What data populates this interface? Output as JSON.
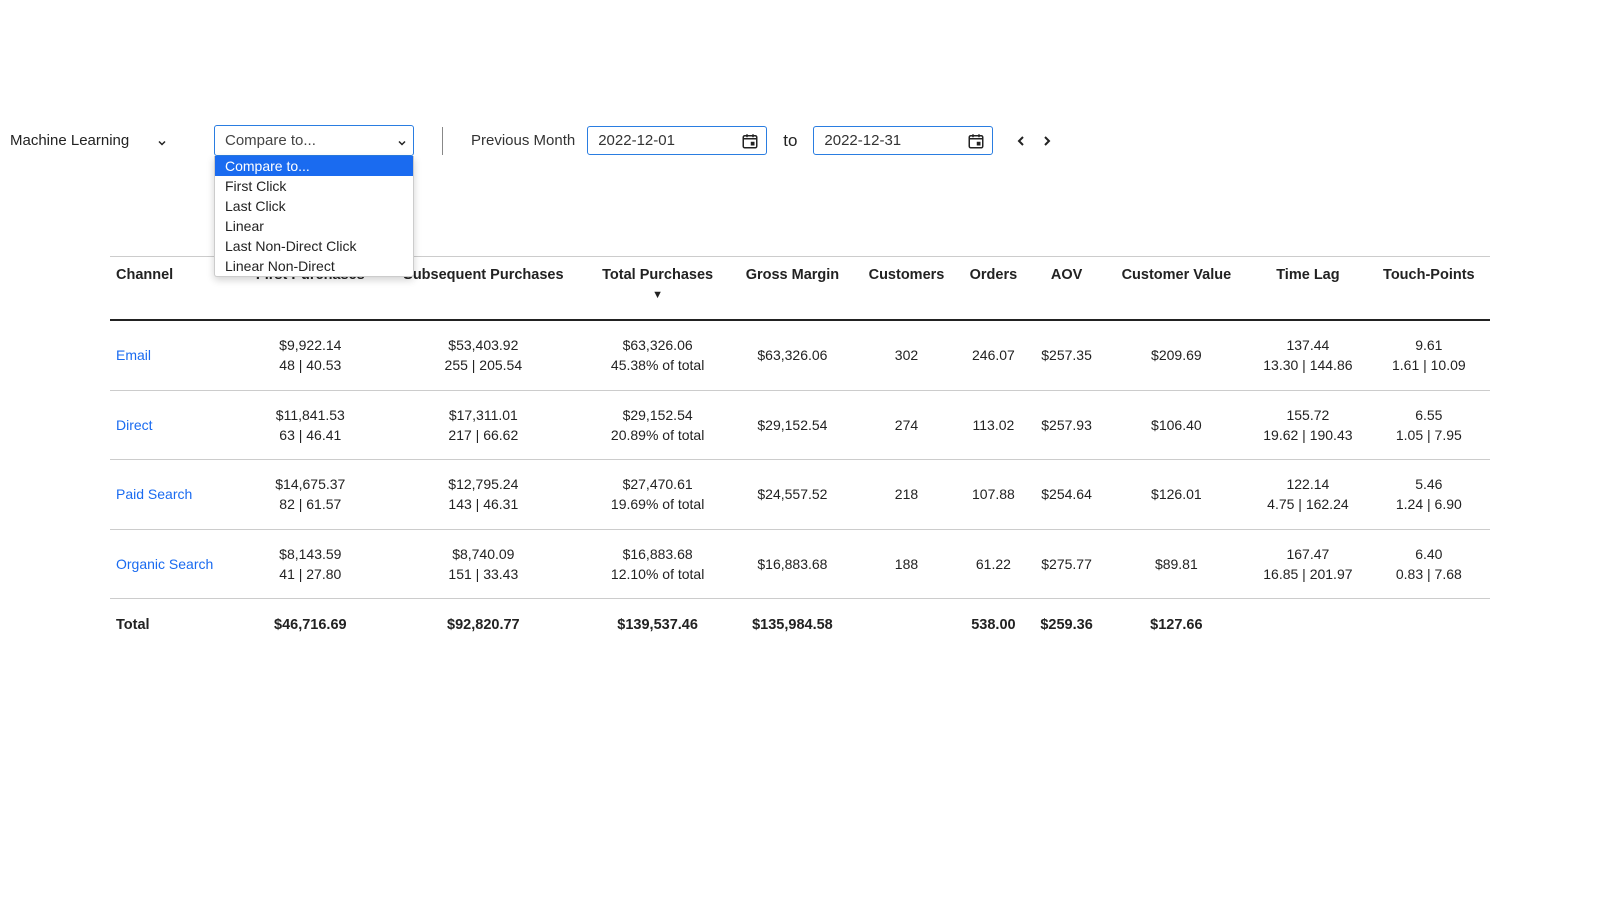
{
  "toolbar": {
    "ml_select": "Machine Learning",
    "compare_selected": "Compare to...",
    "compare_options": [
      "Compare to...",
      "First Click",
      "Last Click",
      "Linear",
      "Last Non-Direct Click",
      "Linear Non-Direct"
    ],
    "prev_label": "Previous Month",
    "date_from": "2022-12-01",
    "to_text": "to",
    "date_to": "2022-12-31"
  },
  "columns": [
    "Channel",
    "First Purchases",
    "Subsequent Purchases",
    "Total Purchases",
    "Gross Margin",
    "Customers",
    "Orders",
    "AOV",
    "Customer Value",
    "Time Lag",
    "Touch-Points"
  ],
  "sort_indicator": "▼",
  "rows": [
    {
      "channel": "Email",
      "first_l1": "$9,922.14",
      "first_l2": "48 | 40.53",
      "sub_l1": "$53,403.92",
      "sub_l2": "255 | 205.54",
      "tot_l1": "$63,326.06",
      "tot_l2": "45.38% of total",
      "gross": "$63,326.06",
      "customers": "302",
      "orders": "246.07",
      "aov": "$257.35",
      "cv": "$209.69",
      "tl_l1": "137.44",
      "tl_l2": "13.30 | 144.86",
      "tp_l1": "9.61",
      "tp_l2": "1.61 | 10.09"
    },
    {
      "channel": "Direct",
      "first_l1": "$11,841.53",
      "first_l2": "63 | 46.41",
      "sub_l1": "$17,311.01",
      "sub_l2": "217 | 66.62",
      "tot_l1": "$29,152.54",
      "tot_l2": "20.89% of total",
      "gross": "$29,152.54",
      "customers": "274",
      "orders": "113.02",
      "aov": "$257.93",
      "cv": "$106.40",
      "tl_l1": "155.72",
      "tl_l2": "19.62 | 190.43",
      "tp_l1": "6.55",
      "tp_l2": "1.05 | 7.95"
    },
    {
      "channel": "Paid Search",
      "first_l1": "$14,675.37",
      "first_l2": "82 | 61.57",
      "sub_l1": "$12,795.24",
      "sub_l2": "143 | 46.31",
      "tot_l1": "$27,470.61",
      "tot_l2": "19.69% of total",
      "gross": "$24,557.52",
      "customers": "218",
      "orders": "107.88",
      "aov": "$254.64",
      "cv": "$126.01",
      "tl_l1": "122.14",
      "tl_l2": "4.75 | 162.24",
      "tp_l1": "5.46",
      "tp_l2": "1.24 | 6.90"
    },
    {
      "channel": "Organic Search",
      "first_l1": "$8,143.59",
      "first_l2": "41 | 27.80",
      "sub_l1": "$8,740.09",
      "sub_l2": "151 | 33.43",
      "tot_l1": "$16,883.68",
      "tot_l2": "12.10% of total",
      "gross": "$16,883.68",
      "customers": "188",
      "orders": "61.22",
      "aov": "$275.77",
      "cv": "$89.81",
      "tl_l1": "167.47",
      "tl_l2": "16.85 | 201.97",
      "tp_l1": "6.40",
      "tp_l2": "0.83 | 7.68"
    }
  ],
  "totals": {
    "label": "Total",
    "first": "$46,716.69",
    "sub": "$92,820.77",
    "tot": "$139,537.46",
    "gross": "$135,984.58",
    "customers": "",
    "orders": "538.00",
    "aov": "$259.36",
    "cv": "$127.66",
    "tl": "",
    "tp": ""
  }
}
